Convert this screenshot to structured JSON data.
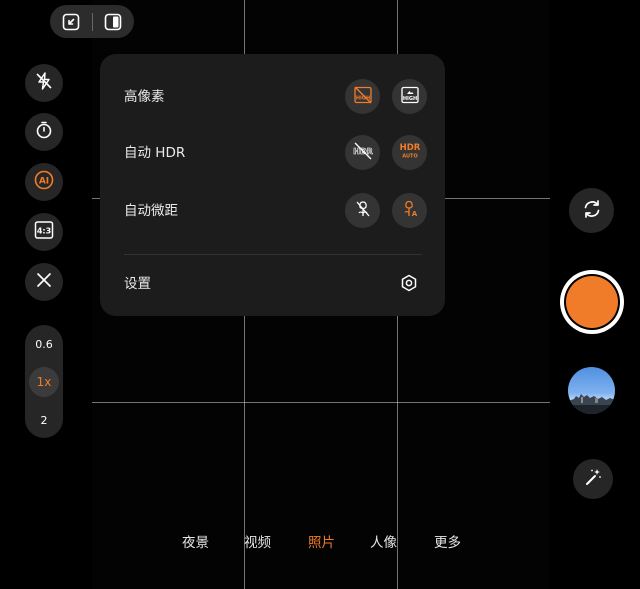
{
  "top_controls": {
    "icons": [
      "collapse-arrows-icon",
      "split-view-icon"
    ]
  },
  "left_controls": [
    {
      "name": "flash-off",
      "icon": "flash-off-icon"
    },
    {
      "name": "timer",
      "icon": "timer-icon"
    },
    {
      "name": "ai",
      "icon": "ai-icon",
      "label": "AI"
    },
    {
      "name": "aspect-ratio",
      "icon": "aspect-ratio-icon",
      "label": "4:3"
    },
    {
      "name": "close",
      "icon": "close-icon"
    }
  ],
  "zoom": {
    "levels": [
      "0.6",
      "1x",
      "2"
    ],
    "selected": "1x"
  },
  "settings_panel": {
    "rows": [
      {
        "label": "高像素",
        "options": [
          {
            "icon": "high-res-off-icon",
            "text": "HIGH"
          },
          {
            "icon": "high-res-on-icon",
            "text": "HIGH"
          }
        ]
      },
      {
        "label": "自动 HDR",
        "options": [
          {
            "icon": "hdr-off-icon",
            "text": "HDR"
          },
          {
            "icon": "hdr-auto-icon",
            "text": "HDR",
            "subtext": "AUTO"
          }
        ]
      },
      {
        "label": "自动微距",
        "options": [
          {
            "icon": "macro-off-icon"
          },
          {
            "icon": "macro-auto-icon",
            "text": "A"
          }
        ]
      }
    ],
    "settings_label": "设置"
  },
  "right_controls": {
    "switch_camera_icon": "switch-camera-icon",
    "shutter_color": "#f07c2a",
    "gallery_thumbnail": "gallery-thumbnail",
    "magic_wand_icon": "magic-wand-icon"
  },
  "modes": {
    "items": [
      "夜景",
      "视频",
      "照片",
      "人像",
      "更多"
    ],
    "selected": "照片"
  },
  "colors": {
    "accent": "#f07c2a",
    "panel_bg": "#1c1c1c",
    "button_bg": "#262626"
  }
}
